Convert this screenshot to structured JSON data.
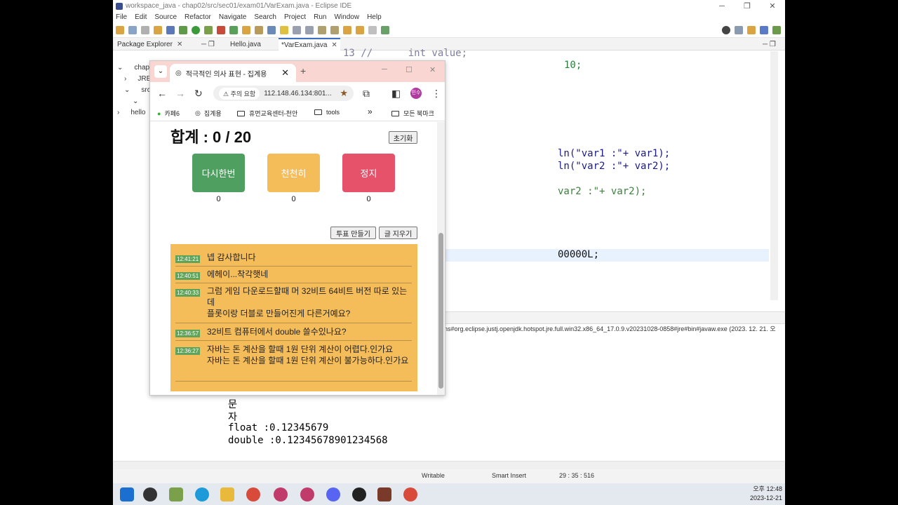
{
  "eclipse": {
    "title": "workspace_java - chap02/src/sec01/exam01/VarExam.java - Eclipse IDE",
    "menu": [
      "File",
      "Edit",
      "Source",
      "Refactor",
      "Navigate",
      "Search",
      "Project",
      "Run",
      "Window",
      "Help"
    ],
    "tabs": {
      "package_explorer": "Package Explorer",
      "hello_java": "Hello.java",
      "varexam_java": "*VarExam.java"
    },
    "tree": [
      "chap0",
      "JRE",
      "src",
      "hello"
    ],
    "code_lines": [
      "13 //      int value;",
      "10;",
      "ln(\"var1 :\"+ var1);",
      "ln(\"var2 :\"+ var2);",
      "var2 :\"+ var2);",
      "00000L;"
    ],
    "console_path": "ns#org.eclipse.justj.openjdk.hotspot.jre.full.win32.x86_64_17.0.9.v20231028-0858#jre#bin#javaw.exe  (2023. 12. 21. 오",
    "console_lines": [
      "문",
      "자",
      "float :0.12345679",
      "double :0.12345678901234568"
    ],
    "status": {
      "writable": "Writable",
      "insert": "Smart Insert",
      "position": "29 : 35 : 516"
    }
  },
  "taskbar": {
    "time": "오후 12:48",
    "date": "2023-12-21"
  },
  "browser": {
    "tab_title": "적극적인 의사 표현 - 집계용",
    "url_warning": "주의 요함",
    "url": "112.148.46.134:801...",
    "profile": "민수",
    "bookmarks": [
      "카페6",
      "집계용",
      "휴먼교육센터-천안",
      "tools",
      "모든 북마크"
    ],
    "page": {
      "sum_label": "합계 : 0 / 20",
      "reset_label": "초기화",
      "votes": [
        {
          "label": "다시한번",
          "count": "0",
          "color": "#4fa060"
        },
        {
          "label": "천천히",
          "count": "0",
          "color": "#f5bd5a"
        },
        {
          "label": "정지",
          "count": "0",
          "color": "#e5526a"
        }
      ],
      "make_vote_label": "투표 만들기",
      "clear_label": "글 지우기",
      "messages": [
        {
          "time": "12:41:21",
          "text": "넵 감사합니다"
        },
        {
          "time": "12:40:51",
          "text": "에헤이...착각햇네"
        },
        {
          "time": "12:40:33",
          "text": "그럼 게임 다운로드할때 머 32비트 64비트 버전 따로 있는데\n플롯이랑 더블로 만들어진게 다른거예요?"
        },
        {
          "time": "12:36:57",
          "text": "32비트 컴퓨터에서 double 쓸수있나요?"
        },
        {
          "time": "12:36:27",
          "text": "자바는 돈 계산을 할때 1원 단위 계산이 어렵다.인가요\n자바는 돈 계산을 할때 1원 단위 계산이 불가능하다.인가요"
        }
      ]
    }
  }
}
